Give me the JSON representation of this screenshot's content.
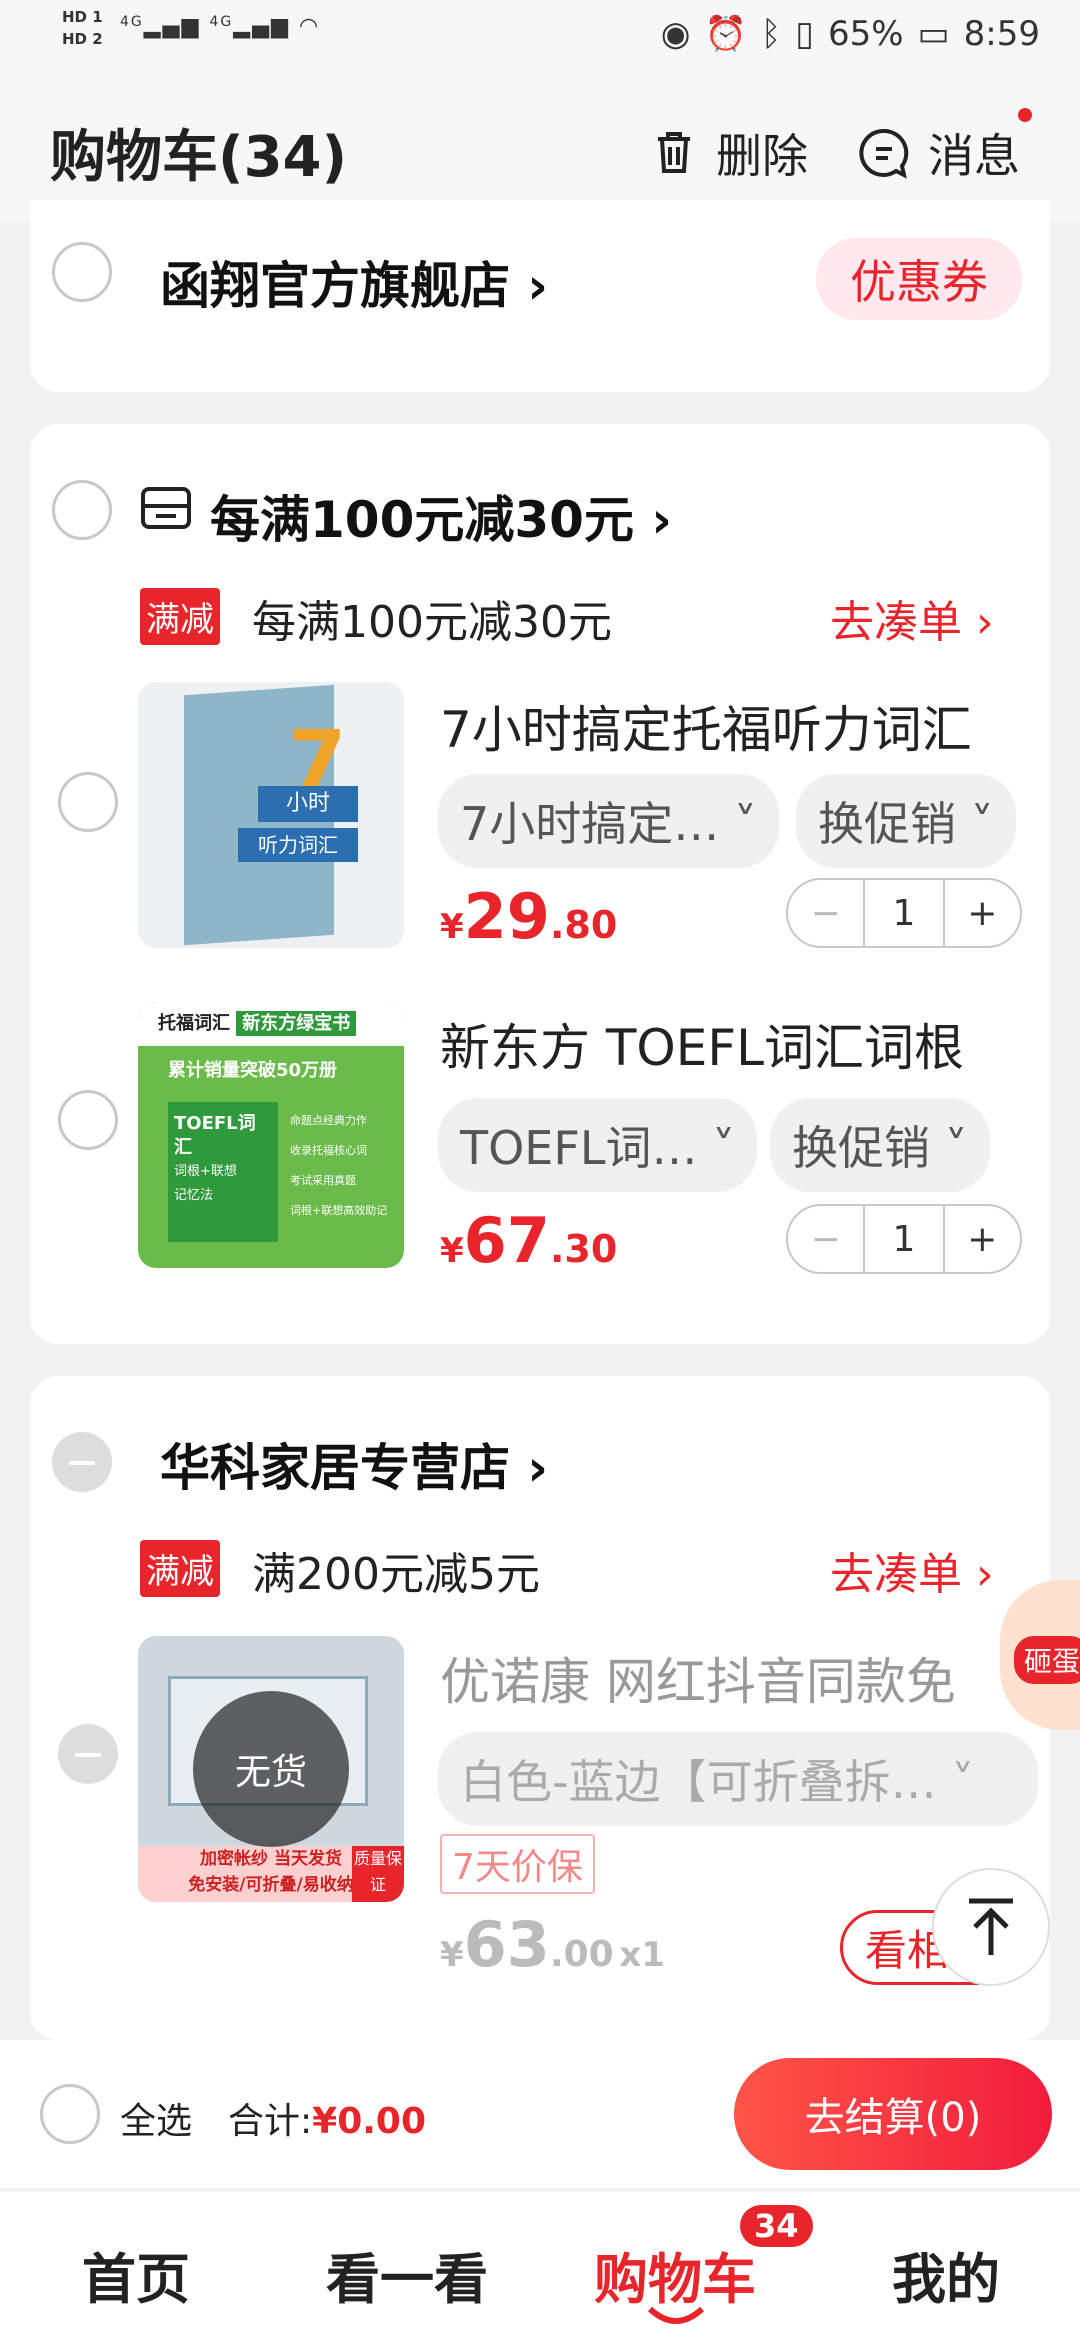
{
  "status": {
    "battery": "65%",
    "time": "8:59",
    "hd1": "HD 1",
    "hd2": "HD 2",
    "net": "4G"
  },
  "header": {
    "title": "购物车(34)",
    "delete_label": "删除",
    "message_label": "消息"
  },
  "shop1": {
    "name": "函翔官方旗舰店",
    "coupon": "优惠券"
  },
  "group": {
    "promo_title": "每满100元减30元",
    "tag": "满减",
    "promo_text": "每满100元减30元",
    "go_add": "去凑单",
    "items": [
      {
        "name": "7小时搞定托福听力词汇",
        "sku": "7小时搞定…",
        "switch": "换促销",
        "price_int": "29",
        "price_dec": ".80",
        "qty": "1"
      },
      {
        "name": "新东方 TOEFL词汇词根",
        "sku": "TOEFL词…",
        "switch": "换促销",
        "price_int": "67",
        "price_dec": ".30",
        "qty": "1"
      }
    ]
  },
  "shop2": {
    "name": "华科家居专营店",
    "tag": "满减",
    "promo_text": "满200元减5元",
    "go_add": "去凑单",
    "item": {
      "name": "优诺康 网红抖音同款免",
      "sku": "白色-蓝边【可折叠拆…",
      "protect": "7天价保",
      "price_int": "63",
      "price_dec": ".00",
      "qty": "x1",
      "stock": "无货",
      "similar": "看相似",
      "side_badge": "砸蛋"
    }
  },
  "book1": {
    "big": "7",
    "line1": "小时",
    "line2": "听力词汇"
  },
  "book2": {
    "head1": "托福词汇",
    "head2": "新东方绿宝书",
    "ribbon": "累计销量突破50万册",
    "cover": "TOEFL词汇",
    "cover2": "词根+联想",
    "cover3": "记忆法",
    "f1": "命题点经典力作",
    "f2": "收录托福核心词",
    "f3": "考试采用真题",
    "f4": "词根+联想高效助记"
  },
  "item3img": {
    "line1": "加密帐纱 当天发货",
    "line2": "免安装/可折叠/易收纳",
    "badge": "质量保证"
  },
  "currency": "¥",
  "footer": {
    "select_all": "全选",
    "total_label": "合计:",
    "total_value": "¥0.00",
    "checkout": "去结算(0)"
  },
  "tabs": [
    {
      "label": "首页"
    },
    {
      "label": "看一看"
    },
    {
      "label": "购物车"
    },
    {
      "label": "我的"
    }
  ],
  "cart_badge": "34",
  "colors": {
    "accent": "#e8252b",
    "background": "#f2f2f2"
  }
}
